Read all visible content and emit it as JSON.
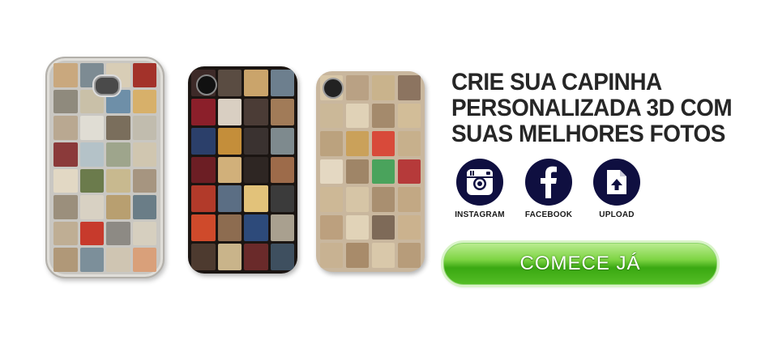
{
  "headline": {
    "line1": "CRIE SUA CAPINHA",
    "line2": "PERSONALIZADA 3D COM",
    "line3": "SUAS MELHORES FOTOS"
  },
  "options": [
    {
      "label": "INSTAGRAM",
      "icon": "instagram-icon"
    },
    {
      "label": "FACEBOOK",
      "icon": "facebook-icon"
    },
    {
      "label": "UPLOAD",
      "icon": "upload-icon"
    }
  ],
  "cta": {
    "label": "COMECE JÁ"
  },
  "colors": {
    "icon_circle": "#0f0f40",
    "cta_green": "#4cb61e",
    "headline": "#262626"
  },
  "phones": {
    "galaxy": {
      "tiles": [
        "#c9a87e",
        "#7d8b93",
        "#d8cdb6",
        "#a3322a",
        "#8f8a7d",
        "#c9c0a8",
        "#6e8fa8",
        "#d7b06a",
        "#b9a891",
        "#e0ddd4",
        "#7a6e5c",
        "#c1bcae",
        "#8b3a3a",
        "#b4c2c8",
        "#9ea58c",
        "#d0c6b0",
        "#e2d8c4",
        "#6b7b4c",
        "#c8b98f",
        "#a69580",
        "#9b8f7c",
        "#d8d1c3",
        "#b89f70",
        "#6a7d87",
        "#bfae94",
        "#c73a2c",
        "#8d8a84",
        "#d6cfbf",
        "#b09878",
        "#7c8f9a",
        "#cfc5b2",
        "#d9a07a"
      ]
    },
    "dark": {
      "tiles": [
        "#3d2a28",
        "#5a4c42",
        "#caa46b",
        "#6d7f8e",
        "#8b1f2a",
        "#d9cfc2",
        "#4b3c36",
        "#a17b58",
        "#2b3f6a",
        "#c48e3a",
        "#3a3230",
        "#7e8a8e",
        "#6c1e24",
        "#d1b07a",
        "#2e2623",
        "#9d6b4a",
        "#b23a2a",
        "#5b6e84",
        "#e2c27a",
        "#3b3b3b",
        "#cf4a2b",
        "#8d6c50",
        "#2d4a7a",
        "#a9a08f",
        "#4d3a2f",
        "#c9b48a",
        "#6a2a2a",
        "#3e4f5f"
      ]
    },
    "beige": {
      "tiles": [
        "#d8c7a8",
        "#b9a184",
        "#c9b38c",
        "#8c7460",
        "#cbb898",
        "#e0d2b7",
        "#a48a6c",
        "#d2bd98",
        "#bba27e",
        "#caa15a",
        "#d84a3a",
        "#c7b08c",
        "#e4d8c2",
        "#9f8567",
        "#4aa35c",
        "#b63a3a",
        "#cdb896",
        "#d6c5a6",
        "#a98f70",
        "#c2a884",
        "#bca07e",
        "#e1d3b8",
        "#7e6a58",
        "#cbb28e",
        "#c8b292",
        "#a88b6a",
        "#d9c8aa",
        "#b79c7a"
      ]
    }
  }
}
